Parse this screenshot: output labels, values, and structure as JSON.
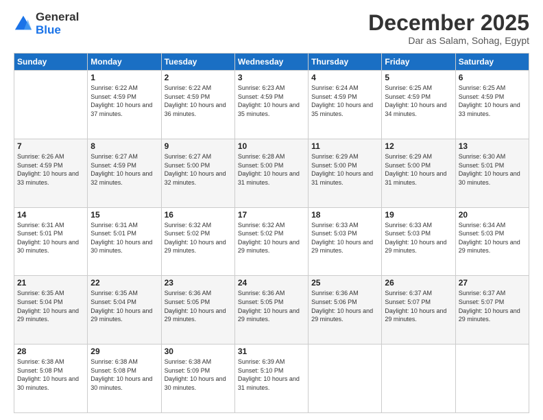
{
  "logo": {
    "line1": "General",
    "line2": "Blue"
  },
  "header": {
    "month_title": "December 2025",
    "location": "Dar as Salam, Sohag, Egypt"
  },
  "days_of_week": [
    "Sunday",
    "Monday",
    "Tuesday",
    "Wednesday",
    "Thursday",
    "Friday",
    "Saturday"
  ],
  "weeks": [
    [
      {
        "day": "",
        "sunrise": "",
        "sunset": "",
        "daylight": ""
      },
      {
        "day": "1",
        "sunrise": "Sunrise: 6:22 AM",
        "sunset": "Sunset: 4:59 PM",
        "daylight": "Daylight: 10 hours and 37 minutes."
      },
      {
        "day": "2",
        "sunrise": "Sunrise: 6:22 AM",
        "sunset": "Sunset: 4:59 PM",
        "daylight": "Daylight: 10 hours and 36 minutes."
      },
      {
        "day": "3",
        "sunrise": "Sunrise: 6:23 AM",
        "sunset": "Sunset: 4:59 PM",
        "daylight": "Daylight: 10 hours and 35 minutes."
      },
      {
        "day": "4",
        "sunrise": "Sunrise: 6:24 AM",
        "sunset": "Sunset: 4:59 PM",
        "daylight": "Daylight: 10 hours and 35 minutes."
      },
      {
        "day": "5",
        "sunrise": "Sunrise: 6:25 AM",
        "sunset": "Sunset: 4:59 PM",
        "daylight": "Daylight: 10 hours and 34 minutes."
      },
      {
        "day": "6",
        "sunrise": "Sunrise: 6:25 AM",
        "sunset": "Sunset: 4:59 PM",
        "daylight": "Daylight: 10 hours and 33 minutes."
      }
    ],
    [
      {
        "day": "7",
        "sunrise": "Sunrise: 6:26 AM",
        "sunset": "Sunset: 4:59 PM",
        "daylight": "Daylight: 10 hours and 33 minutes."
      },
      {
        "day": "8",
        "sunrise": "Sunrise: 6:27 AM",
        "sunset": "Sunset: 4:59 PM",
        "daylight": "Daylight: 10 hours and 32 minutes."
      },
      {
        "day": "9",
        "sunrise": "Sunrise: 6:27 AM",
        "sunset": "Sunset: 5:00 PM",
        "daylight": "Daylight: 10 hours and 32 minutes."
      },
      {
        "day": "10",
        "sunrise": "Sunrise: 6:28 AM",
        "sunset": "Sunset: 5:00 PM",
        "daylight": "Daylight: 10 hours and 31 minutes."
      },
      {
        "day": "11",
        "sunrise": "Sunrise: 6:29 AM",
        "sunset": "Sunset: 5:00 PM",
        "daylight": "Daylight: 10 hours and 31 minutes."
      },
      {
        "day": "12",
        "sunrise": "Sunrise: 6:29 AM",
        "sunset": "Sunset: 5:00 PM",
        "daylight": "Daylight: 10 hours and 31 minutes."
      },
      {
        "day": "13",
        "sunrise": "Sunrise: 6:30 AM",
        "sunset": "Sunset: 5:01 PM",
        "daylight": "Daylight: 10 hours and 30 minutes."
      }
    ],
    [
      {
        "day": "14",
        "sunrise": "Sunrise: 6:31 AM",
        "sunset": "Sunset: 5:01 PM",
        "daylight": "Daylight: 10 hours and 30 minutes."
      },
      {
        "day": "15",
        "sunrise": "Sunrise: 6:31 AM",
        "sunset": "Sunset: 5:01 PM",
        "daylight": "Daylight: 10 hours and 30 minutes."
      },
      {
        "day": "16",
        "sunrise": "Sunrise: 6:32 AM",
        "sunset": "Sunset: 5:02 PM",
        "daylight": "Daylight: 10 hours and 29 minutes."
      },
      {
        "day": "17",
        "sunrise": "Sunrise: 6:32 AM",
        "sunset": "Sunset: 5:02 PM",
        "daylight": "Daylight: 10 hours and 29 minutes."
      },
      {
        "day": "18",
        "sunrise": "Sunrise: 6:33 AM",
        "sunset": "Sunset: 5:03 PM",
        "daylight": "Daylight: 10 hours and 29 minutes."
      },
      {
        "day": "19",
        "sunrise": "Sunrise: 6:33 AM",
        "sunset": "Sunset: 5:03 PM",
        "daylight": "Daylight: 10 hours and 29 minutes."
      },
      {
        "day": "20",
        "sunrise": "Sunrise: 6:34 AM",
        "sunset": "Sunset: 5:03 PM",
        "daylight": "Daylight: 10 hours and 29 minutes."
      }
    ],
    [
      {
        "day": "21",
        "sunrise": "Sunrise: 6:35 AM",
        "sunset": "Sunset: 5:04 PM",
        "daylight": "Daylight: 10 hours and 29 minutes."
      },
      {
        "day": "22",
        "sunrise": "Sunrise: 6:35 AM",
        "sunset": "Sunset: 5:04 PM",
        "daylight": "Daylight: 10 hours and 29 minutes."
      },
      {
        "day": "23",
        "sunrise": "Sunrise: 6:36 AM",
        "sunset": "Sunset: 5:05 PM",
        "daylight": "Daylight: 10 hours and 29 minutes."
      },
      {
        "day": "24",
        "sunrise": "Sunrise: 6:36 AM",
        "sunset": "Sunset: 5:05 PM",
        "daylight": "Daylight: 10 hours and 29 minutes."
      },
      {
        "day": "25",
        "sunrise": "Sunrise: 6:36 AM",
        "sunset": "Sunset: 5:06 PM",
        "daylight": "Daylight: 10 hours and 29 minutes."
      },
      {
        "day": "26",
        "sunrise": "Sunrise: 6:37 AM",
        "sunset": "Sunset: 5:07 PM",
        "daylight": "Daylight: 10 hours and 29 minutes."
      },
      {
        "day": "27",
        "sunrise": "Sunrise: 6:37 AM",
        "sunset": "Sunset: 5:07 PM",
        "daylight": "Daylight: 10 hours and 29 minutes."
      }
    ],
    [
      {
        "day": "28",
        "sunrise": "Sunrise: 6:38 AM",
        "sunset": "Sunset: 5:08 PM",
        "daylight": "Daylight: 10 hours and 30 minutes."
      },
      {
        "day": "29",
        "sunrise": "Sunrise: 6:38 AM",
        "sunset": "Sunset: 5:08 PM",
        "daylight": "Daylight: 10 hours and 30 minutes."
      },
      {
        "day": "30",
        "sunrise": "Sunrise: 6:38 AM",
        "sunset": "Sunset: 5:09 PM",
        "daylight": "Daylight: 10 hours and 30 minutes."
      },
      {
        "day": "31",
        "sunrise": "Sunrise: 6:39 AM",
        "sunset": "Sunset: 5:10 PM",
        "daylight": "Daylight: 10 hours and 31 minutes."
      },
      {
        "day": "",
        "sunrise": "",
        "sunset": "",
        "daylight": ""
      },
      {
        "day": "",
        "sunrise": "",
        "sunset": "",
        "daylight": ""
      },
      {
        "day": "",
        "sunrise": "",
        "sunset": "",
        "daylight": ""
      }
    ]
  ]
}
